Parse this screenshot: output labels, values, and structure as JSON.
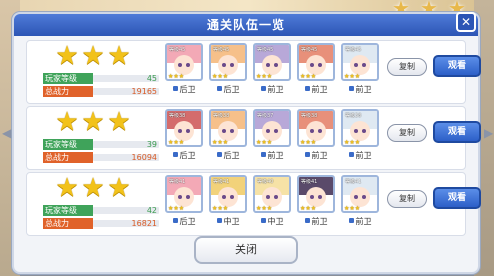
{
  "dialog": {
    "title": "通关队伍一览",
    "close_button_label": "关闭"
  },
  "labels": {
    "player_level": "玩家等级",
    "total_power": "总战力",
    "copy": "复制",
    "view": "观看"
  },
  "teams": [
    {
      "stars": 3,
      "player_level": "45",
      "total_power": "19165",
      "units": [
        {
          "level": "等级45",
          "position": "后卫",
          "hair": "#f3a9b6"
        },
        {
          "level": "等级45",
          "position": "后卫",
          "hair": "#f6c08a"
        },
        {
          "level": "等级45",
          "position": "前卫",
          "hair": "#b8a8d8"
        },
        {
          "level": "等级45",
          "position": "前卫",
          "hair": "#e8907a"
        },
        {
          "level": "等级45",
          "position": "前卫",
          "hair": "#dfe9f2"
        }
      ]
    },
    {
      "stars": 3,
      "player_level": "39",
      "total_power": "16094",
      "units": [
        {
          "level": "等级38",
          "position": "后卫",
          "hair": "#d46c6c"
        },
        {
          "level": "等级38",
          "position": "后卫",
          "hair": "#f6c08a"
        },
        {
          "level": "等级37",
          "position": "前卫",
          "hair": "#b8a8d8"
        },
        {
          "level": "等级38",
          "position": "前卫",
          "hair": "#e8907a"
        },
        {
          "level": "等级38",
          "position": "前卫",
          "hair": "#dfe9f2"
        }
      ]
    },
    {
      "stars": 3,
      "player_level": "42",
      "total_power": "16821",
      "units": [
        {
          "level": "等级41",
          "position": "后卫",
          "hair": "#f3a9b6"
        },
        {
          "level": "等级41",
          "position": "中卫",
          "hair": "#f2d27a"
        },
        {
          "level": "等级40",
          "position": "中卫",
          "hair": "#f6e2a6"
        },
        {
          "level": "等级41",
          "position": "前卫",
          "hair": "#5a4a6a"
        },
        {
          "level": "等级41",
          "position": "前卫",
          "hair": "#dfe9f2"
        }
      ]
    }
  ]
}
